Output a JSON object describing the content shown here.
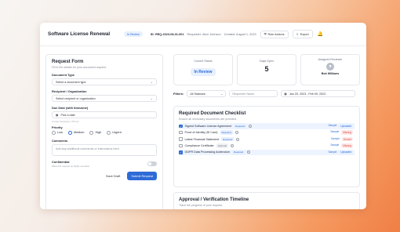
{
  "header": {
    "title": "Software License Renewal",
    "status_badge": "In Review",
    "id_label": "ID:",
    "id_value": "REQ-2023-08-01-001",
    "requester_label": "Requester:",
    "requester": "Alice Johnson",
    "created_label": "Created:",
    "created": "August 1, 2023",
    "role_actions": "Role Actions",
    "export": "Export"
  },
  "form": {
    "title": "Request Form",
    "subtitle": "Fill in the details for your document request.",
    "document_type_label": "Document Type",
    "document_type_value": "Select a document type",
    "recipient_label": "Recipient / Organization",
    "recipient_value": "Select recipient or organization",
    "due_label": "Due Date (with timezone)",
    "due_value": "Pick a date",
    "timezone_hint": "Current timezone: UTC+0",
    "priority_label": "Priority",
    "priority_options": [
      "Low",
      "Medium",
      "High",
      "Urgent"
    ],
    "priority_selected": "Medium",
    "comments_label": "Comments",
    "comments_placeholder": "Add any additional comments or instructions here.",
    "confidential_label": "Confidential",
    "confidential_hint": "Mark this request as highly sensitive.",
    "save_draft": "Save Draft",
    "submit": "Submit Request"
  },
  "summary": {
    "current_status_label": "Current Status",
    "current_status": "In Review",
    "days_open_label": "Days Open",
    "days_open": "5",
    "reviewer_label": "Assigned Reviewer",
    "reviewer": "Bob Williams"
  },
  "filters": {
    "label": "Filters:",
    "status": "All Statuses",
    "requester_placeholder": "Requester Name",
    "date_range": "Jan 20, 2023 - Feb 09, 2023"
  },
  "checklist": {
    "title": "Required Document Checklist",
    "subtitle": "Ensure all necessary documents are provided.",
    "items": [
      {
        "name": "Signed Software License Agreement",
        "tag": "Required",
        "checked": true,
        "sample": "Sample",
        "status": "Uploaded"
      },
      {
        "name": "Proof of Identity (ID Card)",
        "tag": "Required",
        "checked": false,
        "sample": "Sample",
        "status": "Missing"
      },
      {
        "name": "Latest Financial Statement",
        "tag": "Required",
        "checked": false,
        "sample": "Sample",
        "status": "Denied"
      },
      {
        "name": "Compliance Certificate",
        "tag": "Optional",
        "checked": false,
        "sample": "Sample",
        "status": "Missing"
      },
      {
        "name": "GDPR Data Processing Addendum",
        "tag": "Required",
        "checked": true,
        "sample": "Sample",
        "status": "Uploaded"
      }
    ]
  },
  "timeline": {
    "title": "Approval / Verification Timeline",
    "subtitle": "Track the progress of your request."
  },
  "colors": {
    "accent": "#2e6bd6",
    "uploaded": "#2e6bd6",
    "missing": "#d9534f",
    "denied": "#d9534f"
  }
}
